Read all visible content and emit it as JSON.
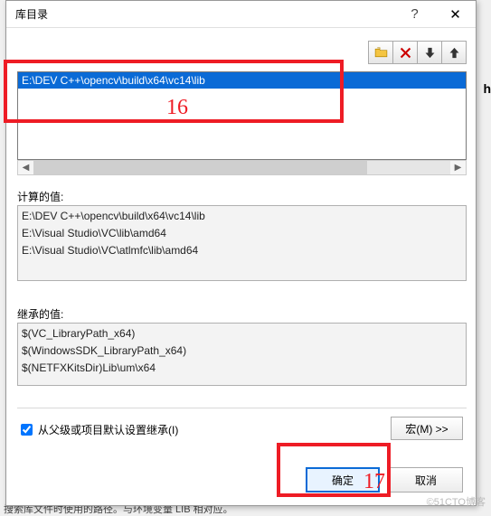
{
  "dialog": {
    "title": "库目录",
    "help_tooltip": "?",
    "close_tooltip": "✕"
  },
  "toolbar": {
    "open": "folder-open-icon",
    "delete": "delete-icon",
    "down": "arrow-down-icon",
    "up": "arrow-up-icon"
  },
  "listbox": {
    "selected": "E:\\DEV C++\\opencv\\build\\x64\\vc14\\lib"
  },
  "labels": {
    "calculated": "计算的值:",
    "inherited": "继承的值:"
  },
  "calc": {
    "l0": "E:\\DEV C++\\opencv\\build\\x64\\vc14\\lib",
    "l1": "E:\\Visual Studio\\VC\\lib\\amd64",
    "l2": "E:\\Visual Studio\\VC\\atlmfc\\lib\\amd64"
  },
  "inherit": {
    "l0": "$(VC_LibraryPath_x64)",
    "l1": "$(WindowsSDK_LibraryPath_x64)",
    "l2": "$(NETFXKitsDir)Lib\\um\\x64"
  },
  "inherit_check": "从父级或项目默认设置继承(I)",
  "buttons": {
    "macro": "宏(M) >>",
    "ok": "确定",
    "cancel": "取消"
  },
  "annotations": {
    "a1": "16",
    "a2": "17"
  },
  "bg_hint": "搜索库文件时使用的路径。与环境变量 LIB 相对应。",
  "watermark": "©51CTO博客",
  "right_char": "h"
}
